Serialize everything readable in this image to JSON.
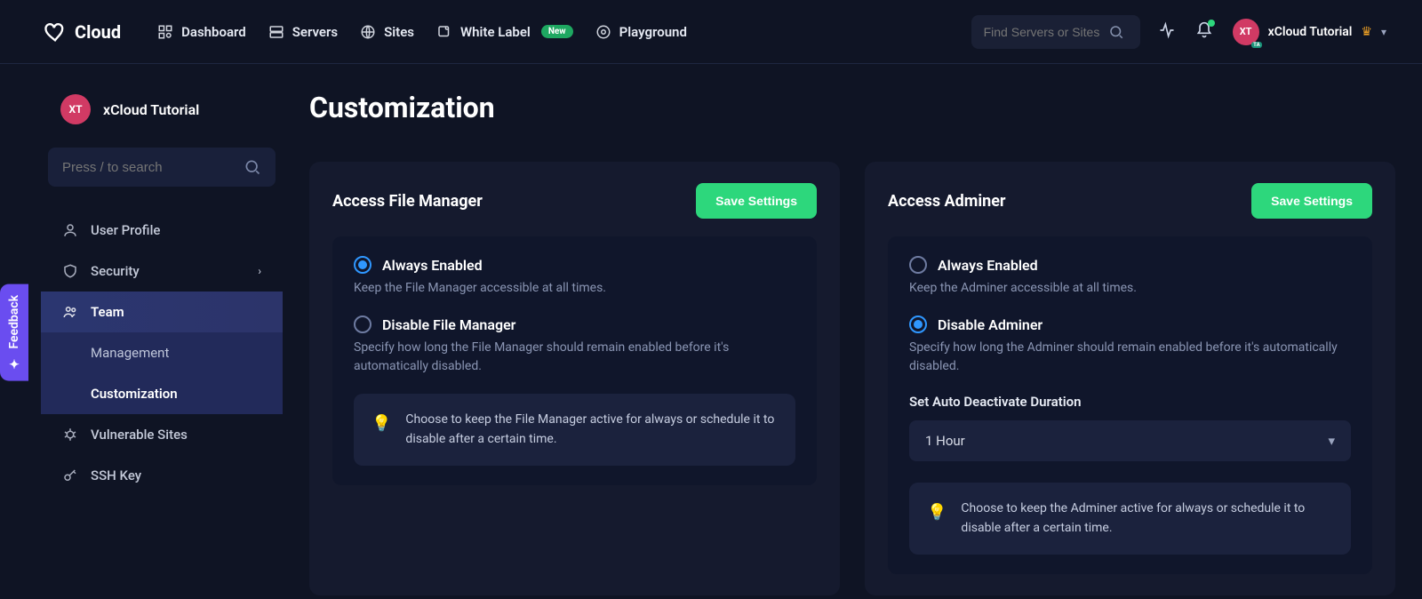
{
  "brand": "Cloud",
  "nav": {
    "dashboard": "Dashboard",
    "servers": "Servers",
    "sites": "Sites",
    "white_label": "White Label",
    "white_label_badge": "New",
    "playground": "Playground"
  },
  "top_search_placeholder": "Find Servers or Sites",
  "user_name": "xCloud Tutorial",
  "avatar_initials": "XT",
  "feedback_label": "Feedback",
  "sidebar": {
    "profile_name": "xCloud Tutorial",
    "profile_initials": "XT",
    "search_placeholder": "Press / to search",
    "items": {
      "user_profile": "User Profile",
      "security": "Security",
      "team": "Team",
      "team_sub": {
        "management": "Management",
        "customization": "Customization"
      },
      "vulnerable_sites": "Vulnerable Sites",
      "ssh_key": "SSH Key"
    }
  },
  "page_title": "Customization",
  "cards": {
    "file_manager": {
      "title": "Access File Manager",
      "save_label": "Save Settings",
      "opt1_label": "Always Enabled",
      "opt1_desc": "Keep the File Manager accessible at all times.",
      "opt2_label": "Disable File Manager",
      "opt2_desc": "Specify how long the File Manager should remain enabled before it's automatically disabled.",
      "selected": "always",
      "hint": "Choose to keep the File Manager active for always or schedule it to disable after a certain time."
    },
    "adminer": {
      "title": "Access Adminer",
      "save_label": "Save Settings",
      "opt1_label": "Always Enabled",
      "opt1_desc": "Keep the Adminer accessible at all times.",
      "opt2_label": "Disable Adminer",
      "opt2_desc": "Specify how long the Adminer should remain enabled before it's automatically disabled.",
      "selected": "disable",
      "duration_label": "Set Auto Deactivate Duration",
      "duration_value": "1 Hour",
      "hint": "Choose to keep the Adminer active for always or schedule it to disable after a certain time."
    }
  }
}
